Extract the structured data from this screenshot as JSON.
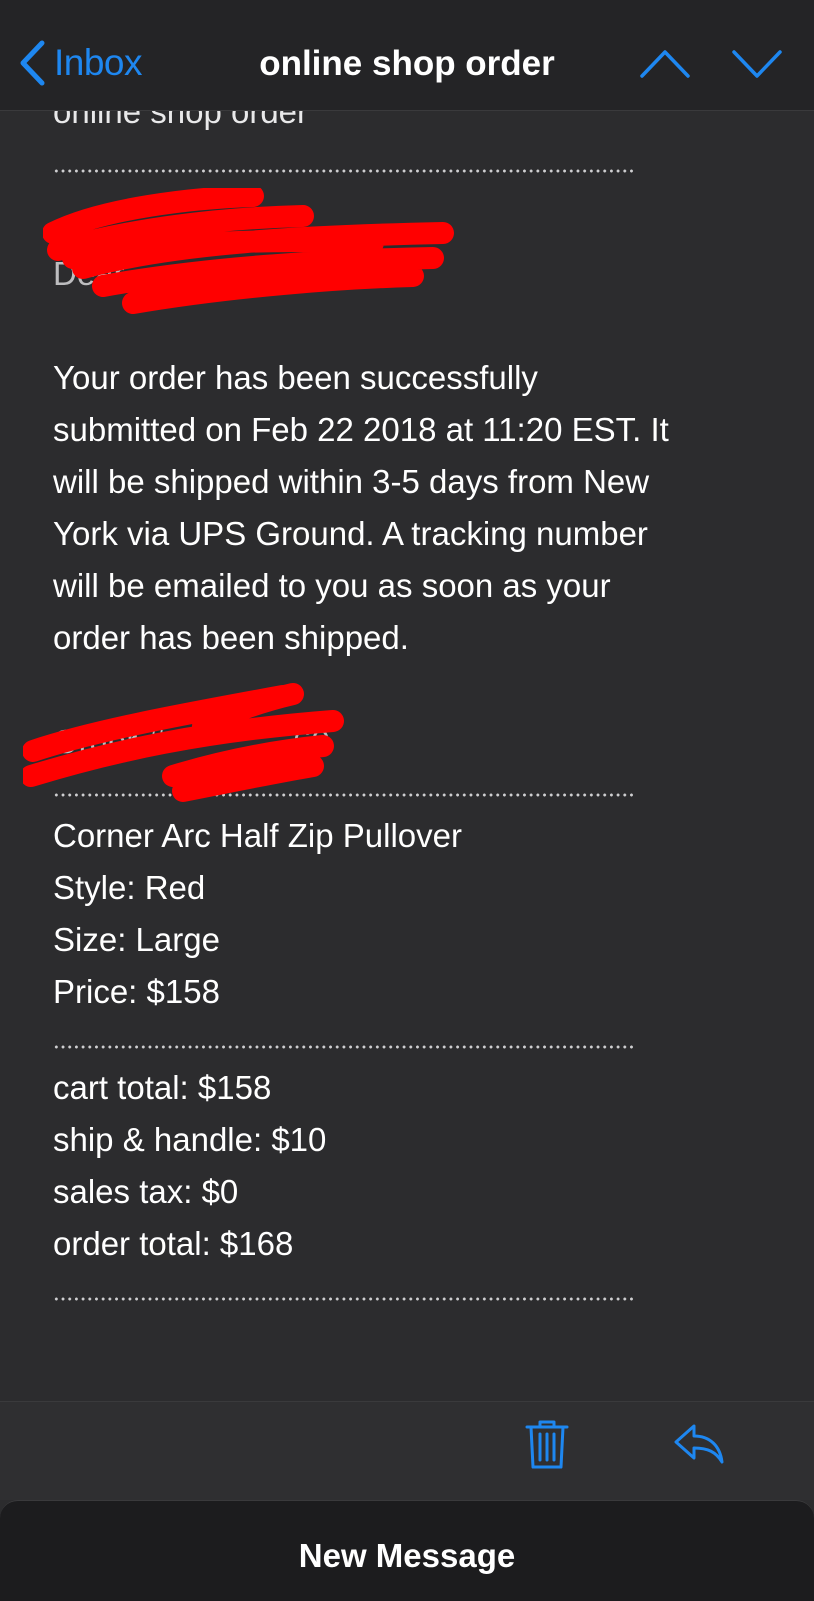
{
  "nav": {
    "back_label": "Inbox",
    "title": "online shop order",
    "prev_icon": "chevron-up-icon",
    "next_icon": "chevron-down-icon"
  },
  "email": {
    "subject_line": "online shop order",
    "greeting_visible": "Dear",
    "body": [
      "Your order has been successfully",
      "submitted on Feb 22 2018 at 11:20 EST. It",
      "will be shipped within 3-5 days from New",
      "York via UPS Ground. A tracking number",
      "will be emailed to you as soon as your",
      "order has been shipped."
    ],
    "order_number_visible": "Order #",
    "order_number_tail": "60",
    "item": {
      "name": "Corner Arc Half Zip Pullover",
      "style": "Style: Red",
      "size": "Size: Large",
      "price": "Price: $158"
    },
    "totals": {
      "cart_total": "cart total: $158",
      "ship_handle": "ship & handle: $10",
      "sales_tax": "sales tax: $0",
      "order_total": "order total: $168"
    }
  },
  "toolbar": {
    "trash_icon": "trash-icon",
    "reply_icon": "reply-icon"
  },
  "compose": {
    "label": "New Message"
  },
  "colors": {
    "accent": "#1e87f0",
    "background": "#2c2c2e",
    "redaction": "#ff0000"
  }
}
